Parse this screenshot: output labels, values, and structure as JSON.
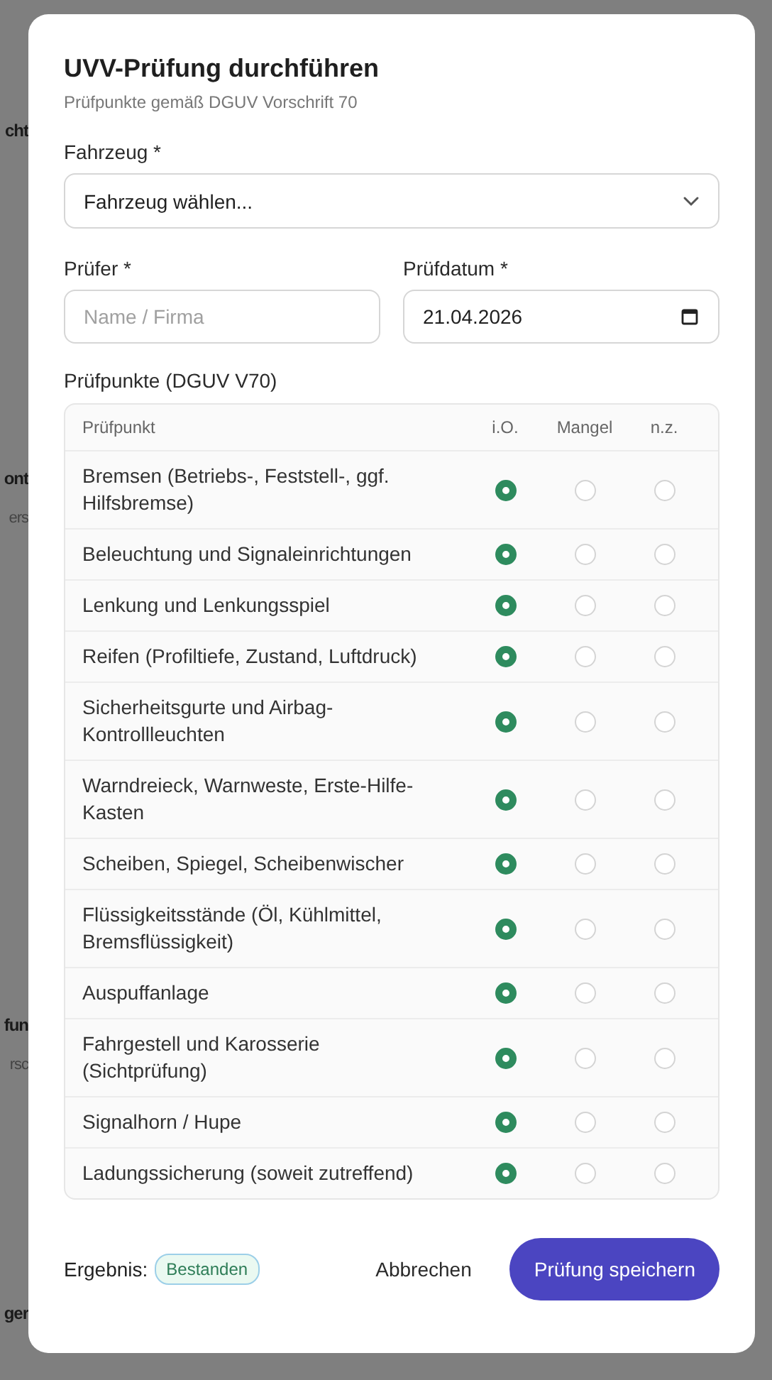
{
  "background_fragments": [
    {
      "text": "cht",
      "kind": "heading"
    },
    {
      "text": "ont",
      "kind": "heading"
    },
    {
      "text": "ers",
      "kind": "sub"
    },
    {
      "text": "fun",
      "kind": "heading"
    },
    {
      "text": "rsc",
      "kind": "sub"
    },
    {
      "text": "ger",
      "kind": "heading"
    }
  ],
  "dialog": {
    "title": "UVV-Prüfung durchführen",
    "subtitle": "Prüfpunkte gemäß DGUV Vorschrift 70"
  },
  "vehicle": {
    "label": "Fahrzeug *",
    "value": "Fahrzeug wählen..."
  },
  "inspector": {
    "label": "Prüfer *",
    "placeholder": "Name / Firma"
  },
  "date": {
    "label": "Prüfdatum *",
    "value": "21.04.2026"
  },
  "checklist": {
    "title": "Prüfpunkte (DGUV V70)",
    "columns": [
      "Prüfpunkt",
      "i.O.",
      "Mangel",
      "n.z."
    ],
    "rows": [
      {
        "label": "Bremsen (Betriebs-, Feststell-, ggf. Hilfsbremse)",
        "ok": true,
        "defect": false,
        "not_applicable": false
      },
      {
        "label": "Beleuchtung und Signaleinrichtungen",
        "ok": true,
        "defect": false,
        "not_applicable": false
      },
      {
        "label": "Lenkung und Lenkungsspiel",
        "ok": true,
        "defect": false,
        "not_applicable": false
      },
      {
        "label": "Reifen (Profiltiefe, Zustand, Luftdruck)",
        "ok": true,
        "defect": false,
        "not_applicable": false
      },
      {
        "label": "Sicherheitsgurte und Airbag-Kontrollleuchten",
        "ok": true,
        "defect": false,
        "not_applicable": false
      },
      {
        "label": "Warndreieck, Warnweste, Erste-Hilfe-Kasten",
        "ok": true,
        "defect": false,
        "not_applicable": false
      },
      {
        "label": "Scheiben, Spiegel, Scheibenwischer",
        "ok": true,
        "defect": false,
        "not_applicable": false
      },
      {
        "label": "Flüssigkeitsstände (Öl, Kühlmittel, Bremsflüssigkeit)",
        "ok": true,
        "defect": false,
        "not_applicable": false
      },
      {
        "label": "Auspuffanlage",
        "ok": true,
        "defect": false,
        "not_applicable": false
      },
      {
        "label": "Fahrgestell und Karosserie (Sichtprüfung)",
        "ok": true,
        "defect": false,
        "not_applicable": false
      },
      {
        "label": "Signalhorn / Hupe",
        "ok": true,
        "defect": false,
        "not_applicable": false
      },
      {
        "label": "Ladungssicherung (soweit zutreffend)",
        "ok": true,
        "defect": false,
        "not_applicable": false
      }
    ]
  },
  "footer": {
    "result_label": "Ergebnis:",
    "result_badge": "Bestanden",
    "passed": true,
    "cancel": "Abbrechen",
    "save": "Prüfung speichern"
  }
}
